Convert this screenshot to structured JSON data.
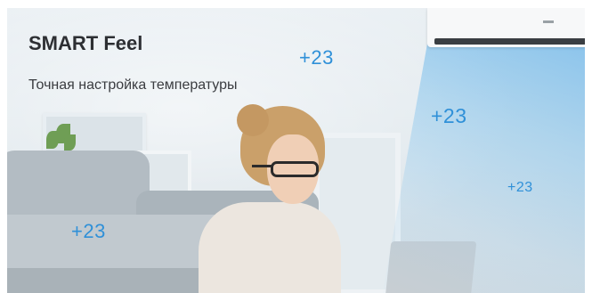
{
  "banner": {
    "title": "SMART Feel",
    "subtitle": "Точная настройка температуры",
    "accent_color": "#2f90d8",
    "temperatures": [
      "+23",
      "+23",
      "+23",
      "+23"
    ]
  },
  "illustration": {
    "subject": "woman-with-laptop-icon",
    "device": "air-conditioner-icon"
  }
}
